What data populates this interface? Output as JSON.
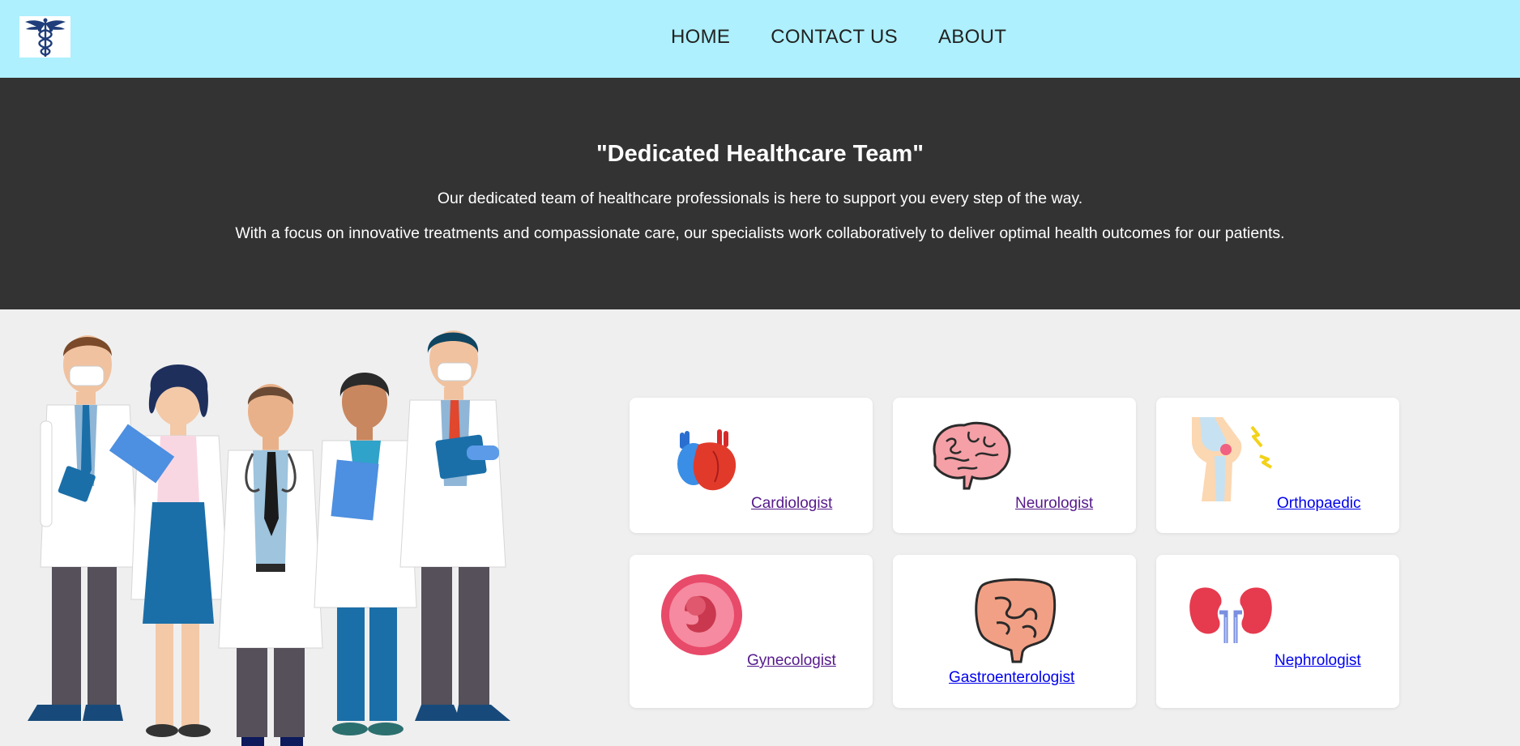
{
  "nav": {
    "logo": "caduceus-icon",
    "links": [
      "HOME",
      "CONTACT US",
      "ABOUT"
    ]
  },
  "hero": {
    "title": "\"Dedicated Healthcare Team\"",
    "para1": "Our dedicated team of healthcare professionals is here to support you every step of the way.",
    "para2": "With a focus on innovative treatments and compassionate care, our specialists work collaboratively to deliver optimal health outcomes for our patients."
  },
  "illustration": "doctors-team-illustration",
  "specialists": [
    {
      "label": "Cardiologist",
      "icon": "heart-icon",
      "visited": true
    },
    {
      "label": "Neurologist",
      "icon": "brain-icon",
      "visited": true
    },
    {
      "label": "Orthopaedic",
      "icon": "knee-joint-icon",
      "visited": false
    },
    {
      "label": "Gynecologist",
      "icon": "fetus-icon",
      "visited": true
    },
    {
      "label": "Gastroenterologist",
      "icon": "intestine-icon",
      "visited": false
    },
    {
      "label": "Nephrologist",
      "icon": "kidneys-icon",
      "visited": false
    }
  ],
  "colors": {
    "navbar": "#aef0fe",
    "hero": "#333333",
    "page": "#efefef",
    "visited_link": "#551a8b",
    "link": "#0000ee"
  }
}
